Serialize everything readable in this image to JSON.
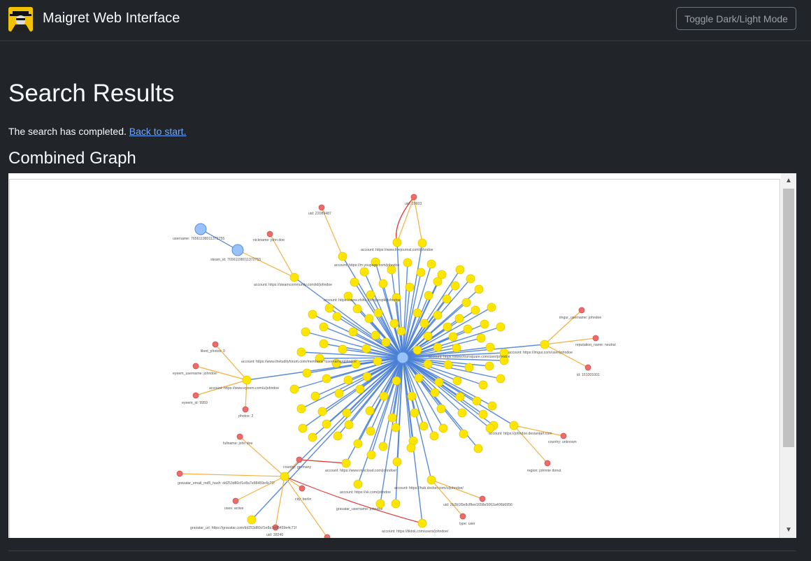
{
  "app": {
    "title": "Maigret Web Interface",
    "toggle_label": "Toggle Dark/Light Mode"
  },
  "page": {
    "heading": "Search Results",
    "status_text": "The search has completed. ",
    "back_link": "Back to start.",
    "graph_heading": "Combined Graph"
  },
  "colors": {
    "background": "#212529",
    "account_node": "#ffe600",
    "detail_node": "#ef6b6b",
    "center_node": "#97c2fc",
    "account_edge": "#4a7fd6",
    "detail_edge": "#f5b041",
    "link_edge": "#e03a3a"
  },
  "graph": {
    "labels": [
      "uid: 22089487",
      "uid: 29603",
      "username: 76561198011372755",
      "steam_id: 76561198011372755",
      "nickname: john doe",
      "account: https://www.livejournal.com/johndoe",
      "account: https://m.youpage.com/johndoe",
      "account: https://steamcommunity.com/id/johndoe",
      "account: https://www.zhihu.com/people/johndoe",
      "imgur_username: johndoe",
      "reputation_name: neutral",
      "id: 151001001",
      "liked_photos: 0",
      "eyeem_username: johndoe",
      "eyeem_id: 9959",
      "photos: 2",
      "fullname: john doe",
      "country: germany",
      "account: https://www.eyeem.com/u/johndoe",
      "account: https://www.thetudityforum.com/members/?username=johndoe",
      "account: https://www.foursquare.com/user/johndoe",
      "account: https://imgur.com/user/johndoe",
      "account: https://www.mixcloud.com/johndoe/",
      "account: https://vk.com/johndoe",
      "account: https://johndoe.deviantart.com",
      "country: unknown",
      "region: johnnie donut",
      "gravatar_email_md5_hash: dd253d80cf1e8a7e88459e4c71f",
      "city: berlin",
      "uses: active",
      "gravatar_url: https://gravatar.com/dd253d80cf1e8a7e88459e4c71f",
      "uid: 38240",
      "gravatar_username: johndoe",
      "account: https://hub.docker.com/u/johndoe/",
      "uid: 2b3b1f0e8cf8ee1658e5062a406b6956",
      "type: user",
      "account: https://tiktok.com/users/johndoe/"
    ]
  }
}
